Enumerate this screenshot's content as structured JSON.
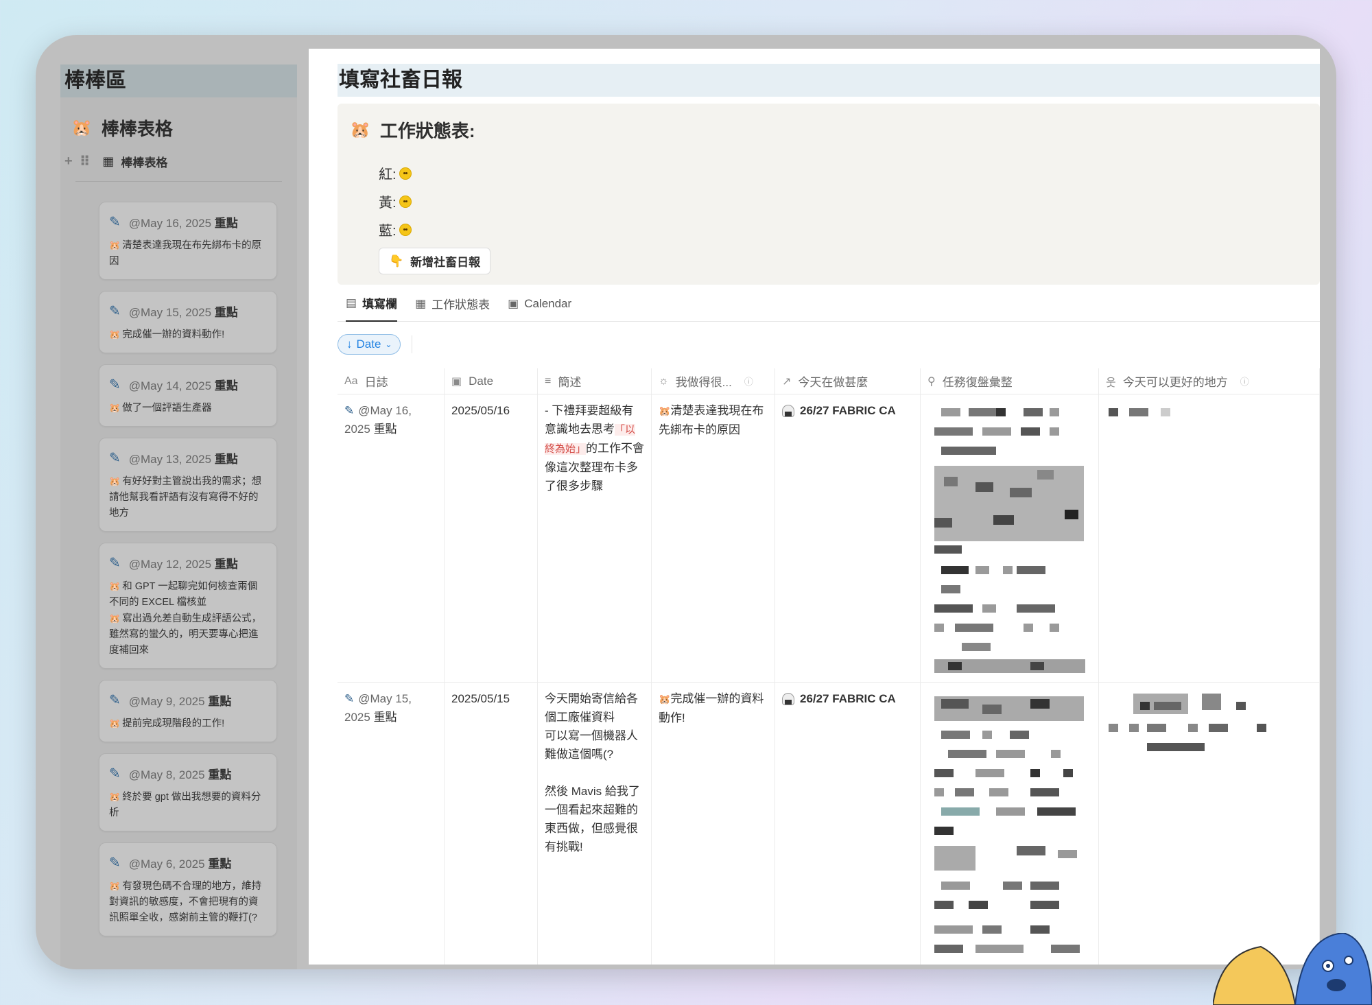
{
  "left": {
    "title": "棒棒區",
    "subtitle": "棒棒表格",
    "view_label": "棒棒表格",
    "cards": [
      {
        "date": "@May 16, 2025",
        "tag": "重點",
        "lines": [
          "清楚表達我現在布先綁布卡的原因"
        ]
      },
      {
        "date": "@May 15, 2025",
        "tag": "重點",
        "lines": [
          "完成催一辦的資料動作!"
        ]
      },
      {
        "date": "@May 14, 2025",
        "tag": "重點",
        "lines": [
          "做了一個評語生產器"
        ]
      },
      {
        "date": "@May 13, 2025",
        "tag": "重點",
        "lines": [
          "有好好對主管說出我的需求；想請他幫我看評語有沒有寫得不好的地方"
        ]
      },
      {
        "date": "@May 12, 2025",
        "tag": "重點",
        "lines": [
          "和 GPT 一起聊完如何檢查兩個不同的 EXCEL 檔核並",
          "寫出過允差自動生成評語公式，雖然寫的蠻久的，明天要專心把進度補回來"
        ]
      },
      {
        "date": "@May 9, 2025",
        "tag": "重點",
        "lines": [
          "提前完成現階段的工作!"
        ]
      },
      {
        "date": "@May 8, 2025",
        "tag": "重點",
        "lines": [
          "終於要 gpt 做出我想要的資料分析"
        ]
      },
      {
        "date": "@May 6, 2025",
        "tag": "重點",
        "lines": [
          "有發現色碼不合理的地方，維持對資訊的敏感度，不會把現有的資訊照單全收，感謝前主管的鞭打(?"
        ]
      }
    ]
  },
  "main": {
    "title": "填寫社畜日報",
    "callout_title": "工作狀態表:",
    "status": [
      {
        "label": "紅:"
      },
      {
        "label": "黃:"
      },
      {
        "label": "藍:"
      }
    ],
    "add_button": "新增社畜日報",
    "tabs": [
      "填寫欄",
      "工作狀態表",
      "Calendar"
    ],
    "filter": "Date",
    "columns": [
      "日誌",
      "Date",
      "簡述",
      "我做得很...",
      "今天在做甚麼",
      "任務復盤彙整",
      "今天可以更好的地方"
    ],
    "rows": [
      {
        "log_date": "@May 16,",
        "log_date2": "2025",
        "log_tag": "重點",
        "date": "2025/05/16",
        "summary_pre": "- 下禮拜要超級有意識地去思考",
        "summary_quote": "「以終為始」",
        "summary_post": "的工作不會像這次整理布卡多了很多步驟",
        "good": "清楚表達我現在布先綁布卡的原因",
        "doing": "26/27 FABRIC CA"
      },
      {
        "log_date": "@May 15,",
        "log_date2": "2025",
        "log_tag": "重點",
        "date": "2025/05/15",
        "summary_a": "今天開始寄信給各個工廠催資料",
        "summary_b": "可以寫一個機器人難做這個嗎(?",
        "summary_c": "然後 Mavis 給我了一個看起來超難的東西做，但感覺很有挑戰!",
        "good": "完成催一辦的資料動作!",
        "doing": "26/27 FABRIC CA"
      }
    ]
  },
  "colors": {
    "accent": "#2383e2",
    "quote_red": "#d44c47",
    "pencil_blue": "#2d5f8b"
  }
}
